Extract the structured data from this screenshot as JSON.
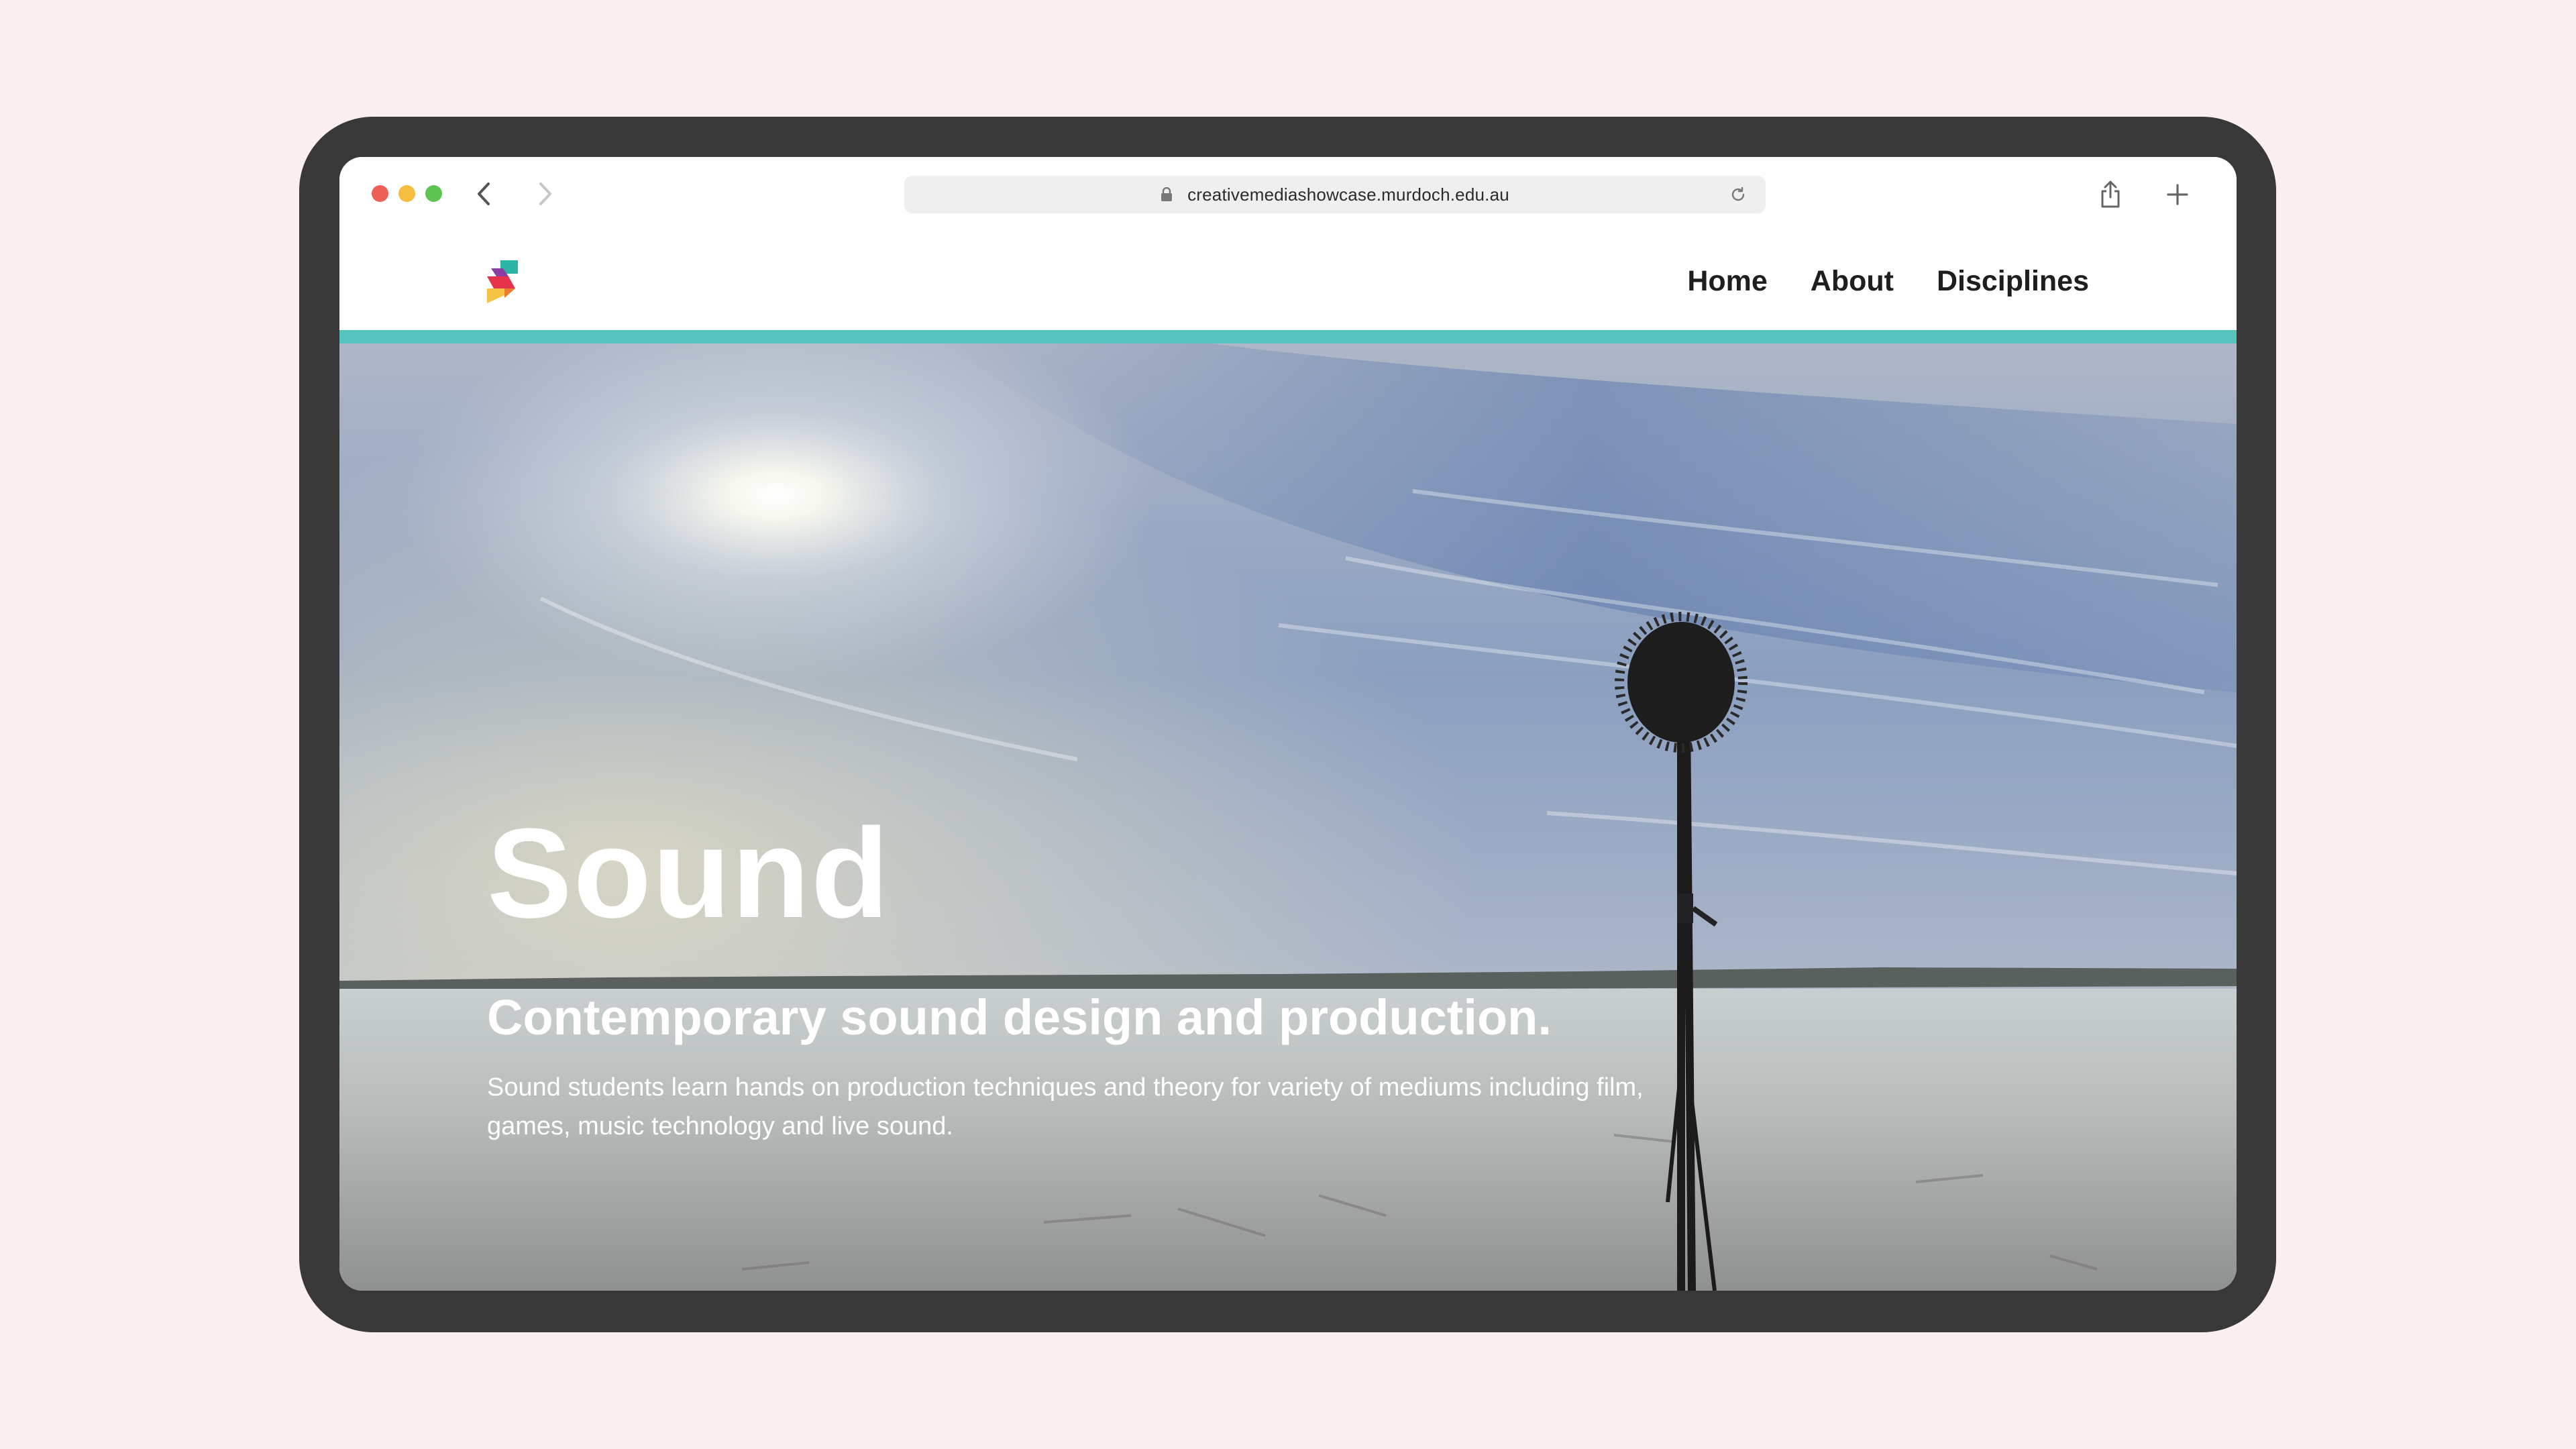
{
  "browser": {
    "url": "creativemediashowcase.murdoch.edu.au"
  },
  "nav": {
    "items": [
      {
        "label": "Home"
      },
      {
        "label": "About"
      },
      {
        "label": "Disciplines"
      }
    ]
  },
  "hero": {
    "title": "Sound",
    "subtitle": "Contemporary sound design and production.",
    "body": "Sound students learn hands on production techniques and theory for variety of mediums including film, games, music technology and live sound."
  },
  "colors": {
    "accent": "#56c4bd",
    "device_frame": "#383838",
    "page_background": "#fcefef"
  },
  "icons": [
    "back-arrow-icon",
    "forward-arrow-icon",
    "lock-icon",
    "reload-icon",
    "share-icon",
    "new-tab-plus-icon",
    "site-logo-icon",
    "microphone-icon"
  ]
}
